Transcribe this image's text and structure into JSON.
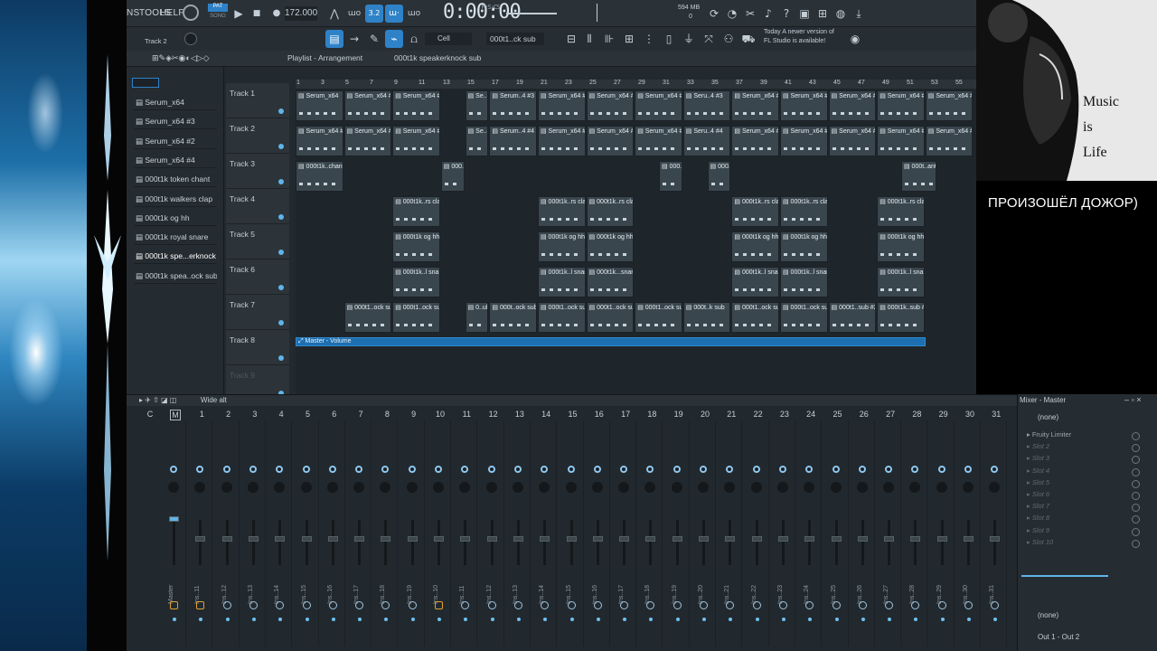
{
  "menu": [
    "NS",
    "TOOLS",
    "HELP"
  ],
  "transport": {
    "pattern_label": "PAT",
    "song_label": "SONG",
    "tempo": "172.000",
    "time": "0:00:00",
    "time_sub": "M:S:CS",
    "cpu": "594 MB",
    "cpu_sub": "0"
  },
  "toolbar2": {
    "track_label": "Track 2",
    "snap": "Cell",
    "pattern": "000t1..ck sub",
    "news_line1": "Today  A newer version of",
    "news_line2": "FL Studio is available!"
  },
  "playlist": {
    "title": "Playlist - Arrangement",
    "pattern": "000t1k speakerknock sub",
    "ruler": [
      "1",
      "3",
      "5",
      "7",
      "9",
      "11",
      "13",
      "15",
      "17",
      "19",
      "21",
      "23",
      "25",
      "27",
      "29",
      "31",
      "33",
      "35",
      "37",
      "39",
      "41",
      "43",
      "45",
      "47",
      "49",
      "51",
      "53",
      "55"
    ]
  },
  "patterns": [
    "Serum_x64",
    "Serum_x64 #3",
    "Serum_x64 #2",
    "Serum_x64 #4",
    "000t1k token chant",
    "000t1k walkers clap",
    "000t1k og hh",
    "000t1k royal snare",
    "000t1k spe...erknock sub",
    "000t1k spea..ock sub #2"
  ],
  "tracks": [
    "Track 1",
    "Track 2",
    "Track 3",
    "Track 4",
    "Track 5",
    "Track 6",
    "Track 7",
    "Track 8",
    "Track 9"
  ],
  "clips": {
    "t1": [
      "Serum_x64",
      "Serum_x64 #3",
      "Serum_x64 #3",
      "Se..3",
      "Serum..4 #3",
      "Serum_x64 #3",
      "Serum_x64 #3",
      "Serum_x64 #3",
      "Seru..4 #3",
      "Serum_x64 #3",
      "Serum_x64 #3",
      "Serum_x64 #3",
      "Serum_x64 #3",
      "Serum_x64 #3"
    ],
    "t2": [
      "Serum_x64 #2",
      "Serum_x64 #4",
      "Serum_x64 #4",
      "Se..4",
      "Serum..4 #4",
      "Serum_x64 #4",
      "Serum_x64 #4",
      "Serum_x64 #4",
      "Seru..4 #4",
      "Serum_x64 #4",
      "Serum_x64 #4",
      "Serum_x64 #4",
      "Serum_x64 #4",
      "Serum_x64 #4"
    ],
    "t3": [
      "000t1k..chant",
      "000..t",
      "000..t",
      "000..t",
      "000t..ant"
    ],
    "t4": [
      "000t1k..rs clap",
      "000t1k..rs clap",
      "000t1k..rs clap",
      "000t1k..rs clap",
      "000t1k..rs clap",
      "000t1k..rs clap"
    ],
    "t5": [
      "000t1k og hh",
      "000t1k og hh",
      "000t1k og hh",
      "000t1k og hh",
      "000t1k og hh",
      "000t1k og hh"
    ],
    "t6": [
      "000t1k..l snare",
      "000t1k..l snare",
      "000t1k...snare",
      "000t1k..l snare",
      "000t1k..l snare",
      "000t1k..l snare"
    ],
    "t7": [
      "000t1..ock sub",
      "000t1..ock sub",
      "0..ub",
      "000t..ock sub",
      "000t1..ock sub",
      "000t1..ock sub",
      "000t1..ock sub",
      "000t..k sub",
      "000t1..ock sub",
      "000t1..ock sub",
      "000t1..sub #2",
      "000t1k..sub #2"
    ],
    "t8": "Master - Volume"
  },
  "mixer": {
    "preset": "Wide alt",
    "title": "Mixer - Master",
    "numbers": [
      "C",
      "M",
      "1",
      "2",
      "3",
      "4",
      "5",
      "6",
      "7",
      "8",
      "9",
      "10",
      "11",
      "12",
      "13",
      "14",
      "15",
      "16",
      "17",
      "18",
      "19",
      "20",
      "21",
      "22",
      "23",
      "24",
      "25",
      "26",
      "27",
      "28",
      "29",
      "30",
      "31"
    ],
    "labels": [
      "Master",
      "Ins..11",
      "Ins..12",
      "Ins..13",
      "Ins..14",
      "Ins..15",
      "Ins..16",
      "Ins..17",
      "Ins..18",
      "Ins..19",
      "Ins..10",
      "Ins..11",
      "Ins..12",
      "Ins..13",
      "Ins..14",
      "Ins..15",
      "Ins..16",
      "Ins..17",
      "Ins..18",
      "Ins..19",
      "Ins..20",
      "Ins..21",
      "Ins..22",
      "Ins..23",
      "Ins..24",
      "Ins..25",
      "Ins..26",
      "Ins..27",
      "Ins..28",
      "Ins..29",
      "Ins..30",
      "Ins..31"
    ],
    "input": "(none)",
    "slots": [
      "Fruity Limiter",
      "Slot 2",
      "Slot 3",
      "Slot 4",
      "Slot 5",
      "Slot 6",
      "Slot 7",
      "Slot 8",
      "Slot 9",
      "Slot 10"
    ],
    "eq_none": "(none)",
    "output": "Out 1 - Out 2"
  },
  "overlay": {
    "caption": "ПРОИЗОШЁЛ ДОЖОР)",
    "image_text": [
      "Music",
      "is",
      "Life"
    ]
  },
  "colors": {
    "accent": "#2f82c8",
    "clip": "#3a464e",
    "automation": "#1d6fb0"
  }
}
